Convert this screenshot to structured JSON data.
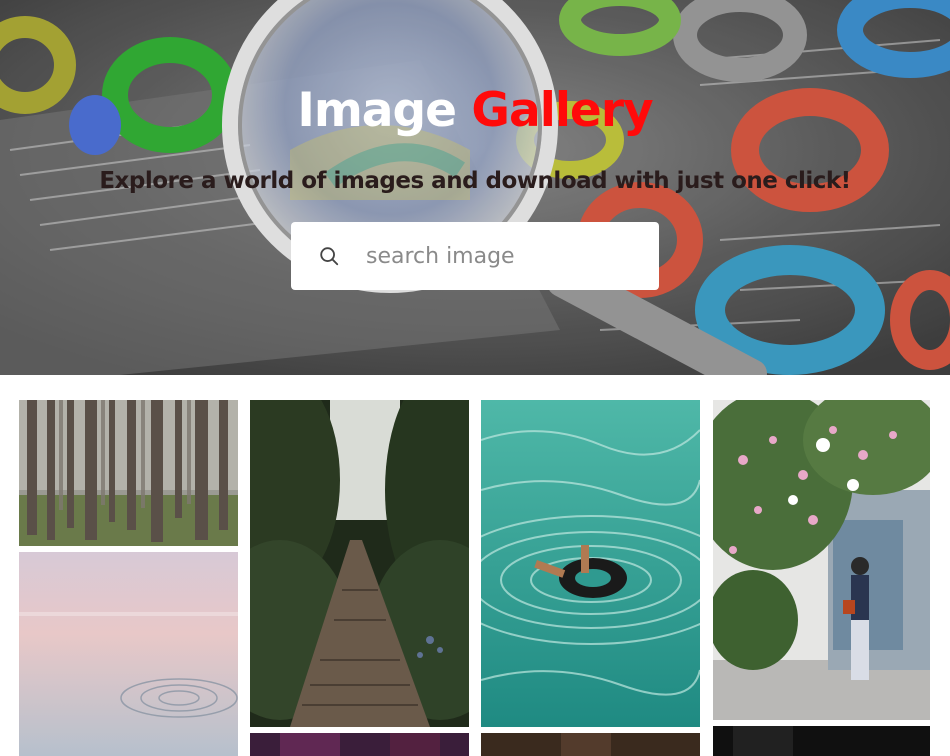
{
  "hero": {
    "title_main": "Image",
    "title_accent": "Gallery",
    "subtitle": "Explore a world of images and download with just one click!",
    "background_icon": "magnifier-and-colored-rings-background",
    "accent_color": "#ff0a0a"
  },
  "search": {
    "placeholder": "search image",
    "value": "",
    "icon": "search-icon"
  },
  "gallery": {
    "images": [
      {
        "name": "forest-trees-image"
      },
      {
        "name": "water-ripple-image"
      },
      {
        "name": "wooden-bridge-forest-image"
      },
      {
        "name": "swimmer-in-tube-image"
      },
      {
        "name": "flowers-and-girl-image"
      },
      {
        "name": "purple-partial-image"
      },
      {
        "name": "brown-partial-image"
      },
      {
        "name": "dark-partial-image"
      }
    ]
  }
}
